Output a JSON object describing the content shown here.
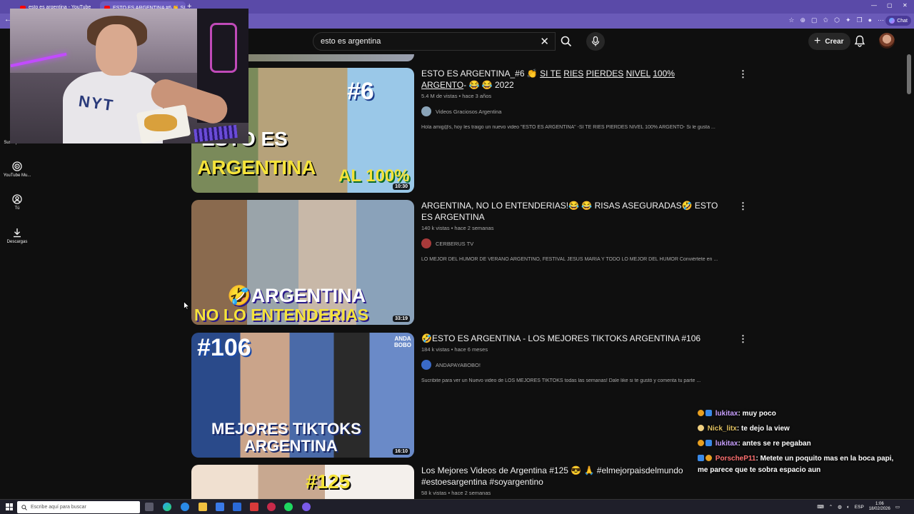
{
  "browser": {
    "tabs": [
      {
        "label": "esto es argentina - YouTube"
      },
      {
        "label": "ESTO ES ARGENTINA #6 👏 SI TE"
      }
    ],
    "chat_button_label": "Chat"
  },
  "header": {
    "search_value": "esto es argentina",
    "create_label": "Crear"
  },
  "sidebar": {
    "items": [
      {
        "label": "Suscripciones",
        "icon": "subscriptions-icon"
      },
      {
        "label": "YouTube Mu...",
        "icon": "youtube-music-icon"
      },
      {
        "label": "Tú",
        "icon": "you-icon"
      },
      {
        "label": "Descargas",
        "icon": "downloads-icon"
      }
    ]
  },
  "results": [
    {
      "title_parts": [
        "ESTO ES ARGENTINA_#6 👏 ",
        "SI TE",
        " ",
        "RIES",
        " ",
        "PIERDES",
        " ",
        "NIVEL",
        " ",
        "100% ARGENTO",
        "- 😂 😂 2022"
      ],
      "title": "ESTO ES ARGENTINA_#6 👏 SI TE RIES PIERDES NIVEL 100% ARGENTO- 😂 😂 2022",
      "views": "5.4 M de vistas",
      "age": "hace 3 años",
      "channel": "Videos Graciosos Argentina",
      "description": "Hola amig@s, hoy les traigo un nuevo video \"ESTO ES ARGENTINA\" -SI TE RIES PIERDES NIVEL 100% ARGENTO- Si le gusta ...",
      "duration": "10:30",
      "thumb_text": [
        "#6",
        "ESTO ES",
        "ARGENTINA",
        "AL 100%"
      ]
    },
    {
      "title": "ARGENTINA, NO LO ENTENDERIAS!😂 😂 RISAS ASEGURADAS🤣 ESTO ES ARGENTINA",
      "views": "140 k vistas",
      "age": "hace 2 semanas",
      "channel": "CERBERUS TV",
      "description": "LO MEJOR DEL HUMOR DE VERANO ARGENTINO, FESTIVAL JESUS MARIA Y TODO LO MEJOR DEL HUMOR Conviértete en ...",
      "duration": "33:19",
      "thumb_text": [
        "🤣ARGENTINA",
        "NO LO ENTENDERIAS"
      ]
    },
    {
      "title": "🤣ESTO ES ARGENTINA - LOS MEJORES TIKTOKS ARGENTINA #106",
      "views": "184 k vistas",
      "age": "hace 6 meses",
      "channel": "ANDAPAYABOBO!",
      "description": "Sucribite para ver un Nuevo video de LOS MEJORES TIKTOKS todas las semanas! Dale like si te gustó y comenta tu parte ...",
      "duration": "16:10",
      "thumb_text": [
        "#106",
        "MEJORES TIKTOKS",
        "ARGENTINA",
        "ANDA BOBO"
      ]
    },
    {
      "title": "Los Mejores Videos de Argentina #125 😎 🙏 #elmejorpaisdelmundo #estoesargentina #soyargentino",
      "views": "58 k vistas",
      "age": "hace 2 semanas",
      "channel": "",
      "description": "",
      "duration": "",
      "thumb_text": [
        "#125"
      ]
    }
  ],
  "chat": [
    {
      "user": "lukitax",
      "message": ": muy poco",
      "color": "#c9a0ff"
    },
    {
      "user": "Nick_litx",
      "message": ": te dejo la view",
      "color": "#e0c060"
    },
    {
      "user": "lukitax",
      "message": ": antes se re pegaban",
      "color": "#c9a0ff"
    },
    {
      "user": "PorscheP11",
      "message": ": Metete un poquito mas en la boca papi, me parece que te sobra espacio aun",
      "color": "#ff7070"
    }
  ],
  "taskbar": {
    "search_placeholder": "Escribe aquí para buscar",
    "lang": "ESP",
    "time": "1:06",
    "date": "18/02/2026"
  },
  "colors": {
    "browser_chrome": "#5a4aa8",
    "yt_background": "#0f0f0f"
  }
}
